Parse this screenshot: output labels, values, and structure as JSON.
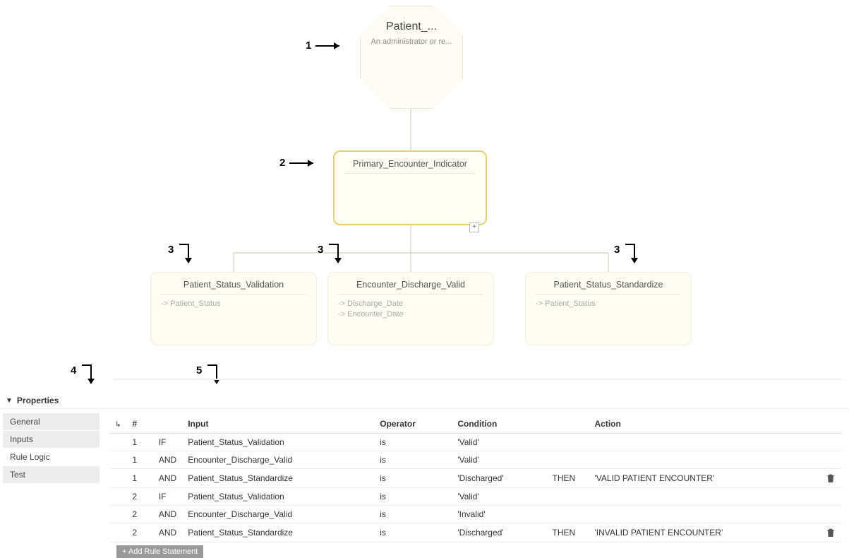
{
  "annotations": {
    "a1": "1",
    "a2": "2",
    "a3_left": "3",
    "a3_mid": "3",
    "a3_right": "3",
    "a4": "4",
    "a5": "5"
  },
  "diagram": {
    "root": {
      "title": "Patient_...",
      "subtitle": "An administrator or re..."
    },
    "selected": {
      "title": "Primary_Encounter_Indicator"
    },
    "plus": "+",
    "child_left": {
      "title": "Patient_Status_Validation",
      "fields": [
        "-> Patient_Status"
      ]
    },
    "child_mid": {
      "title": "Encounter_Discharge_Valid",
      "fields": [
        "-> Discharge_Date",
        "-> Encounter_Date"
      ]
    },
    "child_right": {
      "title": "Patient_Status_Standardize",
      "fields": [
        "-> Patient_Status"
      ]
    }
  },
  "properties": {
    "header": "Properties",
    "tabs": [
      "General",
      "Inputs",
      "Rule Logic",
      "Test"
    ],
    "active_tab_index": 2,
    "columns": [
      "#",
      "",
      "Input",
      "Operator",
      "Condition",
      "",
      "Action"
    ],
    "rows": [
      {
        "num": "1",
        "kw": "IF",
        "input": "Patient_Status_Validation",
        "op": "is",
        "cond": "'Valid'",
        "then": "",
        "action": ""
      },
      {
        "num": "1",
        "kw": "AND",
        "input": "Encounter_Discharge_Valid",
        "op": "is",
        "cond": "'Valid'",
        "then": "",
        "action": ""
      },
      {
        "num": "1",
        "kw": "AND",
        "input": "Patient_Status_Standardize",
        "op": "is",
        "cond": "'Discharged'",
        "then": "THEN",
        "action": "'VALID PATIENT ENCOUNTER'"
      },
      {
        "num": "2",
        "kw": "IF",
        "input": "Patient_Status_Validation",
        "op": "is",
        "cond": "'Valid'",
        "then": "",
        "action": ""
      },
      {
        "num": "2",
        "kw": "AND",
        "input": "Encounter_Discharge_Valid",
        "op": "is",
        "cond": "'Invalid'",
        "then": "",
        "action": ""
      },
      {
        "num": "2",
        "kw": "AND",
        "input": "Patient_Status_Standardize",
        "op": "is",
        "cond": "'Discharged'",
        "then": "THEN",
        "action": "'INVALID PATIENT ENCOUNTER'"
      }
    ],
    "add_button": "+ Add Rule Statement"
  }
}
